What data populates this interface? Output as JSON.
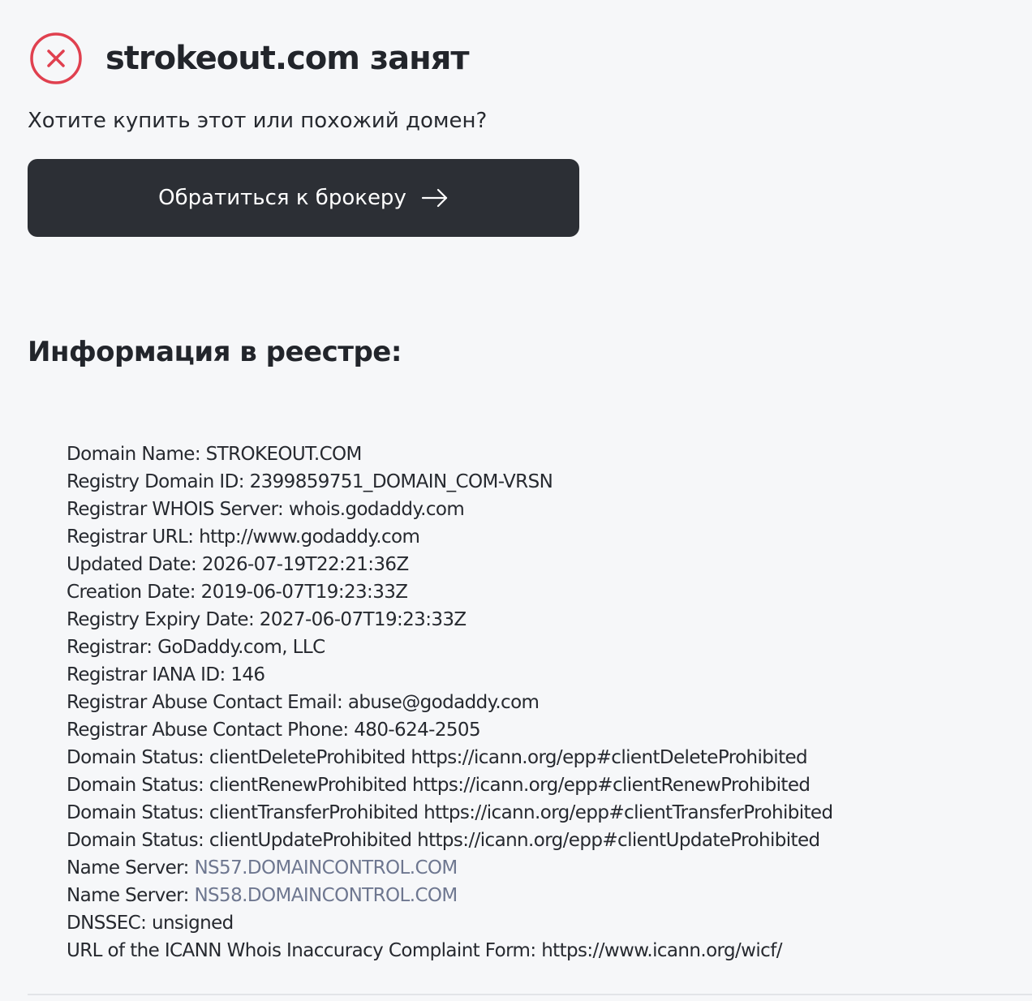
{
  "header": {
    "title": "strokeout.com занят",
    "status_icon": "close-circle-icon",
    "status_color": "#e0404f"
  },
  "question": "Хотите купить этот или похожий домен?",
  "broker_button": {
    "label": "Обратиться к брокеру",
    "icon": "arrow-right-icon",
    "background": "#2c2f35"
  },
  "registry": {
    "title": "Информация в реестре:",
    "domain_name": "Domain Name: STROKEOUT.COM",
    "registry_domain_id": "Registry Domain ID: 2399859751_DOMAIN_COM-VRSN",
    "whois_server": "Registrar WHOIS Server: whois.godaddy.com",
    "registrar_url": "Registrar URL: http://www.godaddy.com",
    "updated_date": "Updated Date: 2026-07-19T22:21:36Z",
    "creation_date": "Creation Date: 2019-06-07T19:23:33Z",
    "expiry_date": "Registry Expiry Date: 2027-06-07T19:23:33Z",
    "registrar": "Registrar: GoDaddy.com, LLC",
    "iana_id": "Registrar IANA ID: 146",
    "abuse_email": "Registrar Abuse Contact Email: abuse@godaddy.com",
    "abuse_phone": "Registrar Abuse Contact Phone: 480-624-2505",
    "status_delete": "Domain Status: clientDeleteProhibited https://icann.org/epp#clientDeleteProhibited",
    "status_renew": "Domain Status: clientRenewProhibited https://icann.org/epp#clientRenewProhibited",
    "status_transfer": "Domain Status: clientTransferProhibited https://icann.org/epp#clientTransferProhibited",
    "status_update": "Domain Status: clientUpdateProhibited https://icann.org/epp#clientUpdateProhibited",
    "name_server_label": "Name Server: ",
    "name_server_1": "NS57.DOMAINCONTROL.COM",
    "name_server_2": "NS58.DOMAINCONTROL.COM",
    "name_server_link_color": "#6e7790",
    "dnssec": "DNSSEC: unsigned",
    "icann_form": "URL of the ICANN Whois Inaccuracy Complaint Form: https://www.icann.org/wicf/"
  }
}
